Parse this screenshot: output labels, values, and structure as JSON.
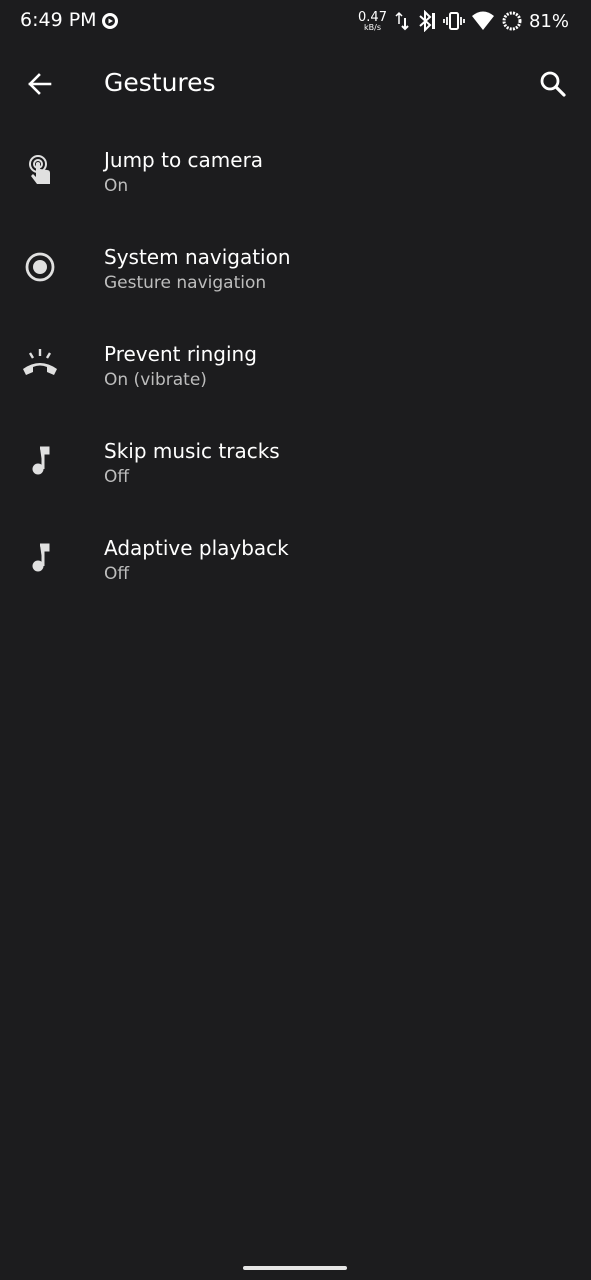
{
  "status_bar": {
    "time": "6:49 PM",
    "net_speed_value": "0.47",
    "net_speed_unit": "kB/s",
    "battery_percent": "81%",
    "icons": [
      "media-app-icon",
      "data-arrows-icon",
      "bluetooth-icon",
      "vibrate-icon",
      "wifi-icon",
      "battery-ring-icon"
    ]
  },
  "app_bar": {
    "title": "Gestures",
    "back_icon": "arrow-back-icon",
    "search_icon": "search-icon"
  },
  "settings": [
    {
      "icon": "touch-camera-icon",
      "title": "Jump to camera",
      "summary": "On"
    },
    {
      "icon": "radio-button-icon",
      "title": "System navigation",
      "summary": "Gesture navigation"
    },
    {
      "icon": "phone-ringing-icon",
      "title": "Prevent ringing",
      "summary": "On (vibrate)"
    },
    {
      "icon": "music-note-icon",
      "title": "Skip music tracks",
      "summary": "Off"
    },
    {
      "icon": "music-note-icon",
      "title": "Adaptive playback",
      "summary": "Off"
    }
  ],
  "colors": {
    "background": "#1c1c1e",
    "text_primary": "#ffffff",
    "text_secondary": "#bdbdbd",
    "icon": "#e0e0e0"
  }
}
